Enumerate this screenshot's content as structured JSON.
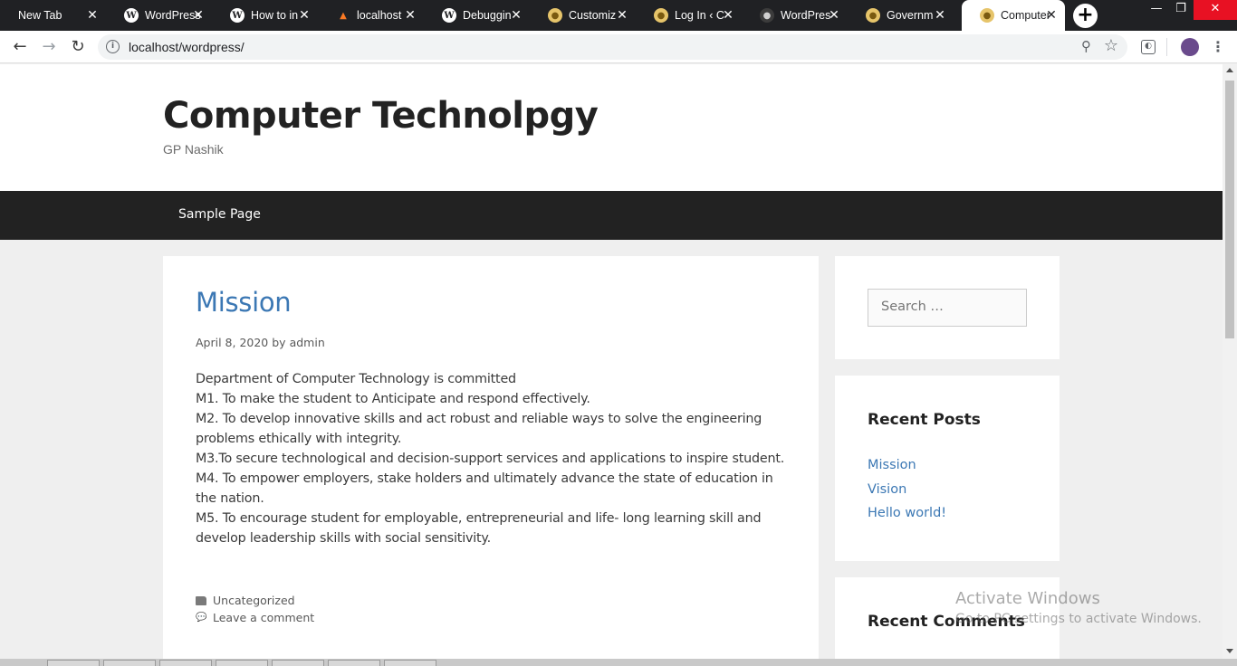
{
  "browser": {
    "tabs": [
      {
        "title": "New Tab",
        "favicon": "none"
      },
      {
        "title": "WordPress",
        "favicon": "wordpress-icon"
      },
      {
        "title": "How to in",
        "favicon": "wordpress-icon"
      },
      {
        "title": "localhost",
        "favicon": "xampp-icon"
      },
      {
        "title": "Debuggin",
        "favicon": "wordpress-icon"
      },
      {
        "title": "Customiz",
        "favicon": "gp-logo-icon"
      },
      {
        "title": "Log In ‹ C",
        "favicon": "gp-logo-icon"
      },
      {
        "title": "WordPres",
        "favicon": "github-icon"
      },
      {
        "title": "Governm",
        "favicon": "gp-logo-icon"
      },
      {
        "title": "Computer",
        "favicon": "gp-logo-icon"
      }
    ],
    "active_tab_index": 9,
    "url": "localhost/wordpress/"
  },
  "site": {
    "title": "Computer Technolpgy",
    "description": "GP Nashik",
    "nav": [
      "Sample Page"
    ]
  },
  "post": {
    "title": "Mission",
    "date": "April 8, 2020",
    "by": "by",
    "author": "admin",
    "body": [
      "Department of Computer Technology is committed",
      "M1. To make the student to Anticipate and respond effectively.",
      "M2. To develop innovative skills and act robust and reliable ways to solve the engineering problems ethically with integrity.",
      "M3.To secure technological and decision-support services and applications to inspire student.",
      "M4. To empower employers, stake holders and ultimately advance the state of education in the nation.",
      "M5. To encourage student for employable, entrepreneurial and life- long learning skill and develop leadership skills with social sensitivity."
    ],
    "category": "Uncategorized",
    "comment_link": "Leave a comment"
  },
  "sidebar": {
    "search_placeholder": "Search …",
    "recent_posts_title": "Recent Posts",
    "recent_posts": [
      "Mission",
      "Vision",
      "Hello world!"
    ],
    "recent_comments_title": "Recent Comments"
  },
  "watermark": {
    "line1": "Activate Windows",
    "line2": "Go to PC settings to activate Windows."
  },
  "colors": {
    "link": "#3c78b4",
    "nav_bg": "#222222",
    "chrome_bg": "#202124"
  }
}
